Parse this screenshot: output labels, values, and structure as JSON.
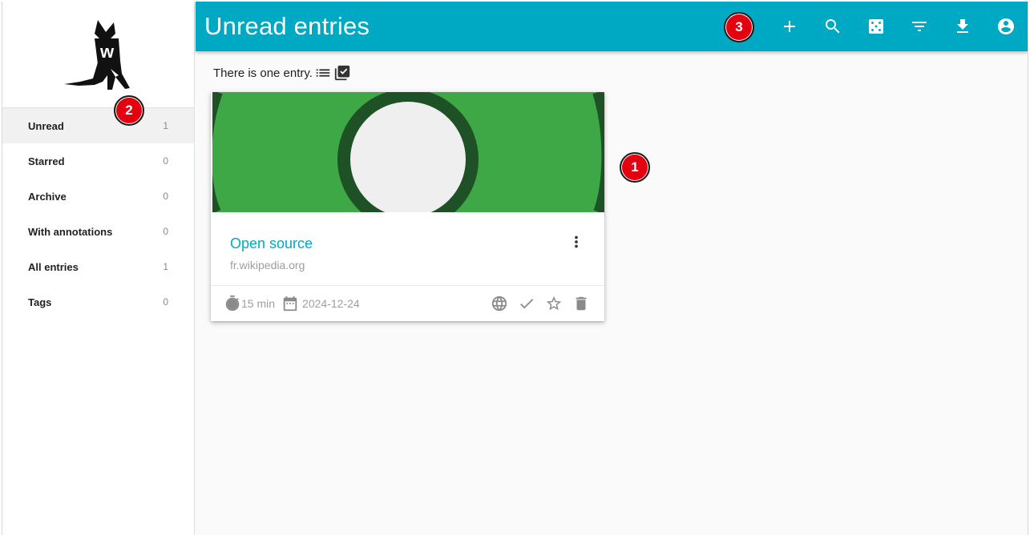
{
  "header": {
    "title": "Unread entries"
  },
  "toolbar": {
    "buttons": [
      {
        "name": "add",
        "icon": "plus-icon"
      },
      {
        "name": "search",
        "icon": "search-icon"
      },
      {
        "name": "random",
        "icon": "dice-icon"
      },
      {
        "name": "filter",
        "icon": "filter-icon"
      },
      {
        "name": "export",
        "icon": "download-icon"
      },
      {
        "name": "account",
        "icon": "account-circle-icon"
      }
    ]
  },
  "sidebar": {
    "items": [
      {
        "label": "Unread",
        "count": "1",
        "active": true
      },
      {
        "label": "Starred",
        "count": "0"
      },
      {
        "label": "Archive",
        "count": "0"
      },
      {
        "label": "With annotations",
        "count": "0"
      },
      {
        "label": "All entries",
        "count": "1"
      },
      {
        "label": "Tags",
        "count": "0"
      }
    ]
  },
  "main": {
    "entry_count_text": "There is one entry.",
    "entries": [
      {
        "title": "Open source",
        "domain": "fr.wikipedia.org",
        "reading_time": "15 min",
        "date": "2024-12-24"
      }
    ]
  },
  "markers": [
    "1",
    "2",
    "3"
  ],
  "colors": {
    "accent": "#00a9c3",
    "marker": "#e3000f",
    "preview_green": "#3ea846",
    "preview_dark_green": "#1e5125"
  }
}
